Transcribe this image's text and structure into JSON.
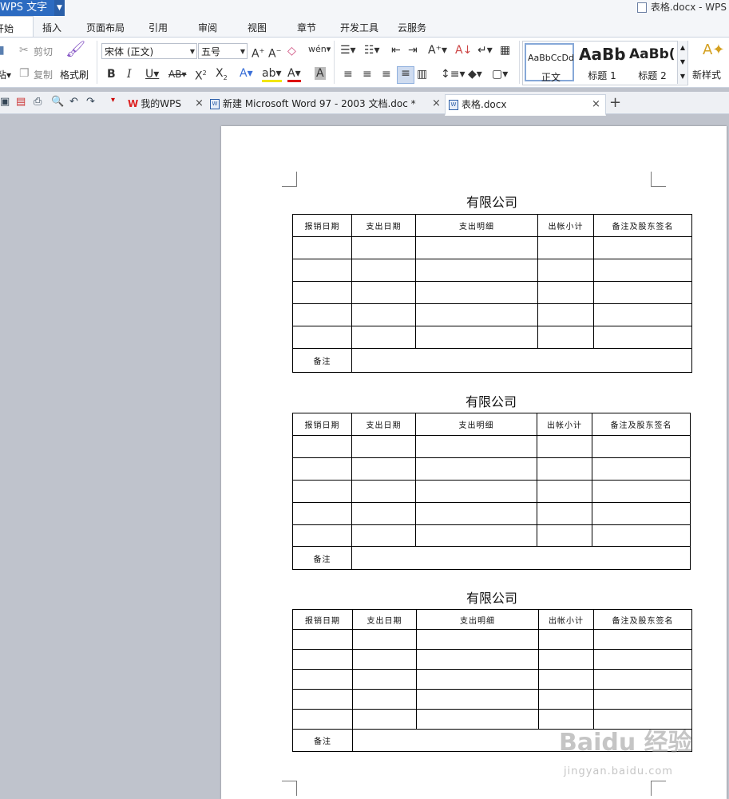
{
  "app": {
    "name": "WPS 文字",
    "window_title": "表格.docx - WPS"
  },
  "menu_tabs": [
    "开始",
    "插入",
    "页面布局",
    "引用",
    "审阅",
    "视图",
    "章节",
    "开发工具",
    "云服务"
  ],
  "ribbon": {
    "cut": "剪切",
    "copy": "复制",
    "paste": "粘贴",
    "format_painter": "格式刷",
    "font_name": "宋体 (正文)",
    "font_size": "五号",
    "styles": [
      {
        "preview": "AaBbCcDd",
        "name": "正文"
      },
      {
        "preview": "AaBb",
        "name": "标题 1"
      },
      {
        "preview": "AaBb(",
        "name": "标题 2"
      }
    ],
    "new_style": "新样式"
  },
  "doc_tabs": [
    {
      "label": "我的WPS"
    },
    {
      "label": "新建 Microsoft Word 97 - 2003 文档.doc *"
    },
    {
      "label": "表格.docx"
    }
  ],
  "document": {
    "tables": [
      {
        "title": "有限公司",
        "headers": [
          "报销日期",
          "支出日期",
          "支出明细",
          "出帐小计",
          "备注及股东签名"
        ],
        "remark_label": "备注"
      },
      {
        "title": "有限公司",
        "headers": [
          "报销日期",
          "支出日期",
          "支出明细",
          "出帐小计",
          "备注及股东签名"
        ],
        "remark_label": "备注"
      },
      {
        "title": "有限公司",
        "headers": [
          "报销日期",
          "支出日期",
          "支出明细",
          "出帐小计",
          "备注及股东签名"
        ],
        "remark_label": "备注"
      }
    ]
  },
  "watermark": {
    "text": "Baidu 经验",
    "url": "jingyan.baidu.com"
  },
  "colors": {
    "app_blue": "#2c6bc1",
    "chrome_bg": "#f4f6f9",
    "workspace": "#bfc3cc"
  }
}
